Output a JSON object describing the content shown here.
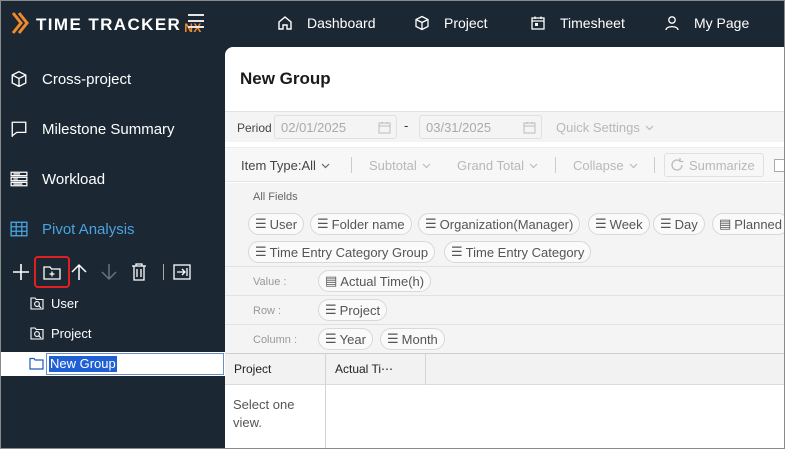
{
  "app": {
    "logo_text": "TIME TRACKER",
    "logo_suffix": "NX"
  },
  "topnav": {
    "dashboard": "Dashboard",
    "project": "Project",
    "timesheet": "Timesheet",
    "mypage": "My Page"
  },
  "sidebar": {
    "items": [
      {
        "label": "Cross-project",
        "icon": "cube-icon"
      },
      {
        "label": "Milestone Summary",
        "icon": "flag-icon"
      },
      {
        "label": "Workload",
        "icon": "workload-icon"
      },
      {
        "label": "Pivot Analysis",
        "icon": "table-icon",
        "active": true
      }
    ],
    "tree": [
      {
        "label": "User",
        "icon": "saved-view-icon"
      },
      {
        "label": "Project",
        "icon": "saved-view-icon"
      }
    ],
    "editing_value": "New Group"
  },
  "main": {
    "title": "New Group",
    "period_label": "Period",
    "date_from": "02/01/2025",
    "date_sep": "-",
    "date_to": "03/31/2025",
    "quick_settings": "Quick Settings",
    "item_type": "Item Type:All",
    "subtotal": "Subtotal",
    "grand_total": "Grand Total",
    "collapse": "Collapse",
    "summarize": "Summarize",
    "all_fields_label": "All Fields",
    "fields": [
      "User",
      "Folder name",
      "Organization(Manager)",
      "Week",
      "Day",
      "Planned",
      "Time Entry Category Group",
      "Time Entry Category"
    ],
    "value_label": "Value :",
    "value_fields": [
      "Actual Time(h)"
    ],
    "row_label": "Row :",
    "row_fields": [
      "Project"
    ],
    "column_label": "Column :",
    "column_fields": [
      "Year",
      "Month"
    ],
    "grid": {
      "col1": "Project",
      "col2": "Actual Ti⋯",
      "empty_message_1": "Select one",
      "empty_message_2": "view."
    }
  },
  "colors": {
    "sidebar_bg": "#1b2733",
    "accent": "#4aa3df",
    "logo_orange": "#f0892b",
    "highlight": "#e02020",
    "selection": "#1e5fd6"
  }
}
